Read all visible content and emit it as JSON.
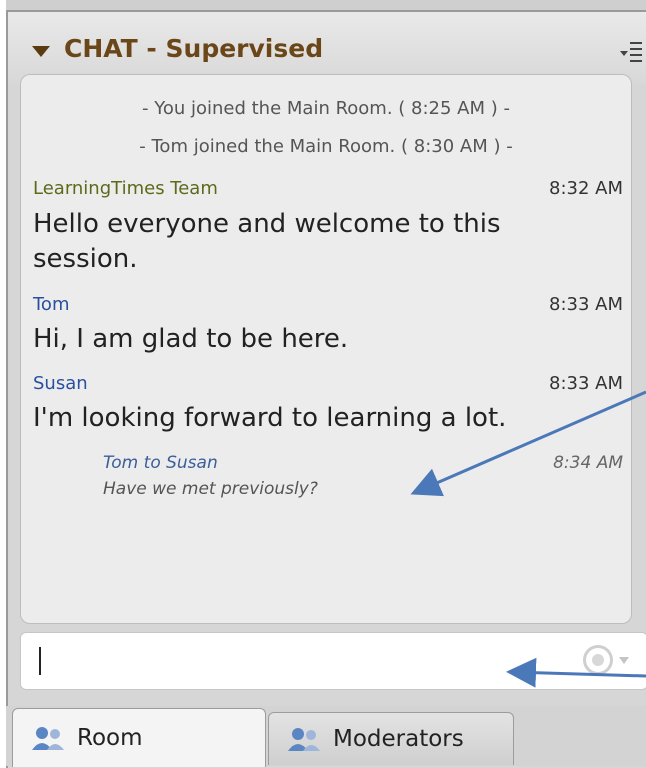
{
  "panel": {
    "title": "CHAT - Supervised",
    "menu_icon": "list-menu-icon",
    "collapse_icon": "caret-down-icon"
  },
  "messages": {
    "system": [
      "- You joined the Main Room. ( 8:25 AM ) -",
      "- Tom joined the Main Room. ( 8:30 AM ) -"
    ],
    "chat": [
      {
        "sender": "LearningTimes Team",
        "time": "8:32 AM",
        "text_line1": "Hello everyone and welcome to this",
        "text_line2": "session.",
        "color": "#5b6b1a"
      },
      {
        "sender": "Tom",
        "time": "8:33 AM",
        "text_line1": "Hi, I am glad to be here.",
        "color": "#2a4fa0"
      },
      {
        "sender": "Susan",
        "time": "8:33 AM",
        "text_line1": "I'm looking forward to learning a lot.",
        "color": "#2a4fa0"
      }
    ],
    "private": {
      "header": "Tom to Susan",
      "time": "8:34 AM",
      "text": "Have we met previously?"
    }
  },
  "input": {
    "value": "",
    "emoji_icon": "smiley-icon"
  },
  "tabs": [
    {
      "label": "Room",
      "icon": "people-icon",
      "active": true
    },
    {
      "label": "Moderators",
      "icon": "people-icon",
      "active": false
    }
  ],
  "colors": {
    "accent_title": "#6b4618",
    "arrow": "#4a78b8"
  }
}
